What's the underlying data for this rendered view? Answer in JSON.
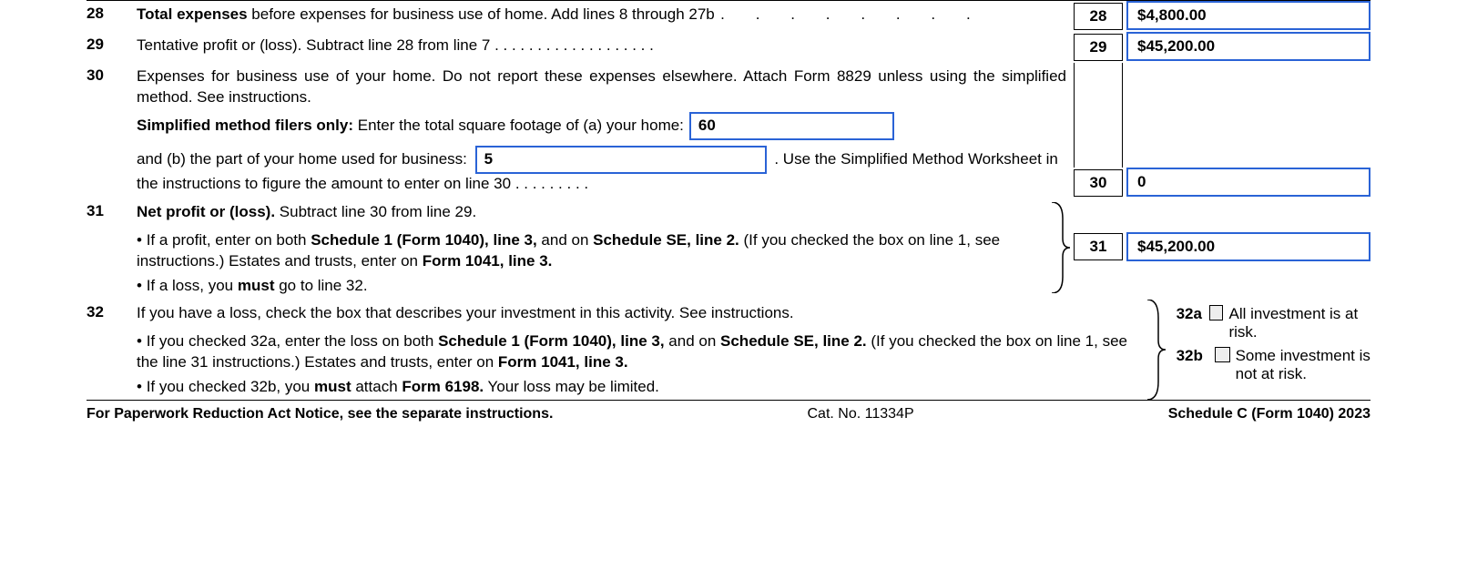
{
  "lines": {
    "l28": {
      "num": "28",
      "textA": "Total expenses",
      "textB": " before expenses for business use of home. Add lines 8 through 27b",
      "boxNum": "28",
      "value": "$4,800.00"
    },
    "l29": {
      "num": "29",
      "text": "Tentative profit or (loss). Subtract line 28 from line 7",
      "boxNum": "29",
      "value": "$45,200.00"
    },
    "l30": {
      "num": "30",
      "textA": "Expenses for business use of your home. Do not report these expenses elsewhere. Attach Form 8829 unless using the simplified method. See instructions.",
      "textB_bold": "Simplified method filers only:",
      "textB_rest": " Enter the total square footage of (a) your home:",
      "sqft_home": "60",
      "textC_prefix": "and (b) the part of your home used for business:",
      "sqft_biz": "5",
      "textC_suffix": " . Use the Simplified Method Worksheet in the instructions to figure the amount to enter on line 30",
      "boxNum": "30",
      "value": "0"
    },
    "l31": {
      "num": "31",
      "title": "Net profit or (loss).",
      "titleRest": " Subtract line 30 from line 29.",
      "bullet1a": "If a profit, enter on both ",
      "bullet1b": "Schedule 1 (Form 1040), line 3,",
      "bullet1c": " and on ",
      "bullet1d": "Schedule SE, line 2.",
      "bullet1e": " (If you checked the box on line 1, see instructions.) Estates and trusts, enter on ",
      "bullet1f": "Form 1041, line 3.",
      "bullet2a": "If a loss, you ",
      "bullet2b": "must",
      "bullet2c": "  go to line 32.",
      "boxNum": "31",
      "value": "$45,200.00"
    },
    "l32": {
      "num": "32",
      "intro": "If you have a loss, check the box that describes your investment in this activity. See instructions.",
      "b1a": "If you checked 32a, enter the loss on both ",
      "b1b": "Schedule 1 (Form 1040), line 3,",
      "b1c": " and on ",
      "b1d": "Schedule SE, line 2.",
      "b1e": " (If you checked the box on line 1, see the line 31 instructions.) Estates and trusts, enter on ",
      "b1f": "Form 1041, line 3.",
      "b2a": "If you checked 32b, you ",
      "b2b": "must",
      "b2c": " attach ",
      "b2d": "Form 6198.",
      "b2e": " Your loss may be limited.",
      "opt32a_num": "32a",
      "opt32a_label": "All investment is at risk.",
      "opt32b_num": "32b",
      "opt32b_label": "Some investment is not at risk."
    }
  },
  "footer": {
    "left": "For Paperwork Reduction Act Notice, see the separate instructions.",
    "mid": "Cat. No. 11334P",
    "right": "Schedule C (Form 1040) 2023"
  }
}
